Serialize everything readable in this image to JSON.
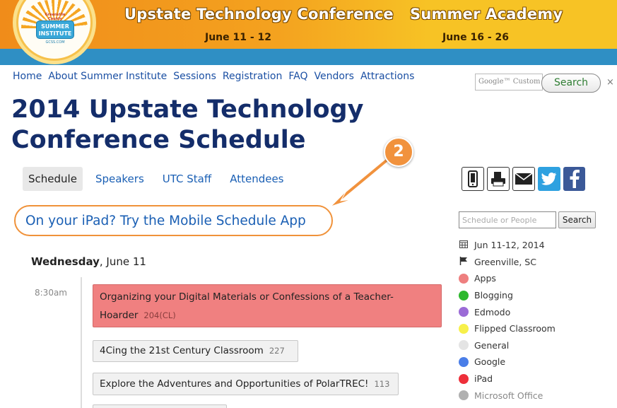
{
  "banner": {
    "logo_top_text": "Greenville County Schools",
    "logo_line1": "SUMMER",
    "logo_line2": "INSTITUTE",
    "logo_url": "GCSS.COM",
    "conference_title": "Upstate Technology Conference",
    "conference_dates": "June 11 - 12",
    "academy_title": "Summer Academy",
    "academy_dates": "June 16 - 26"
  },
  "nav": {
    "items": [
      "Home",
      "About Summer Institute",
      "Sessions",
      "Registration",
      "FAQ",
      "Vendors",
      "Attractions"
    ]
  },
  "google_search": {
    "placeholder": "Google™ Custom",
    "button": "Search",
    "close": "×"
  },
  "page_title": "2014 Upstate Technology Conference Schedule",
  "tabs": [
    "Schedule",
    "Speakers",
    "UTC Staff",
    "Attendees"
  ],
  "share_icons": [
    "mobile-icon",
    "print-icon",
    "email-icon",
    "twitter-icon",
    "facebook-icon"
  ],
  "callout_number": "2",
  "mobile_promo": "On your iPad? Try the Mobile Schedule App",
  "day_header": {
    "day": "Wednesday",
    "date": ", June 11"
  },
  "schedule": {
    "time": "8:30am",
    "events": [
      {
        "title": "Organizing your Digital Materials or Confessions of a Teacher-Hoarder",
        "title_line1": "Organizing your Digital Materials or Confessions of a Teacher-",
        "title_line2": "Hoarder",
        "room": "204(CL)",
        "category": "Apps"
      },
      {
        "title": "4Cing the 21st Century Classroom",
        "room": "227"
      },
      {
        "title": "Explore the Adventures and Opportunities of PolarTREC!",
        "room": "113"
      }
    ]
  },
  "sidebar": {
    "search_placeholder": "Schedule or People",
    "search_button": "Search",
    "date": "Jun 11-12, 2014",
    "location": "Greenville, SC",
    "categories": [
      {
        "name": "Apps",
        "color": "#ee7f7f"
      },
      {
        "name": "Blogging",
        "color": "#2db82d"
      },
      {
        "name": "Edmodo",
        "color": "#9b6bd6"
      },
      {
        "name": "Flipped Classroom",
        "color": "#f7f04a"
      },
      {
        "name": "General",
        "color": "#e4e4e4"
      },
      {
        "name": "Google",
        "color": "#4a7ee8"
      },
      {
        "name": "iPad",
        "color": "#ee2f3a"
      },
      {
        "name": "Microsoft Office",
        "color": "#b0b0b0"
      }
    ]
  }
}
